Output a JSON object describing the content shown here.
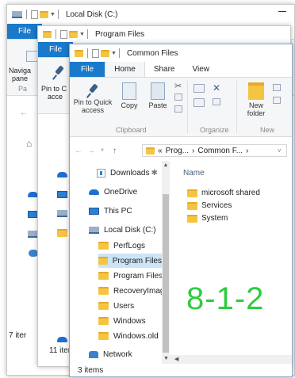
{
  "windows": {
    "local_disk": {
      "title": "Local Disk (C:)",
      "tab_file": "File",
      "ribbon_label_navigation": "Naviga",
      "ribbon_label_pane": "pane",
      "ribbon_label_pa": "Pa",
      "status": "7 iter"
    },
    "program_files": {
      "title": "Program Files",
      "tab_file": "File",
      "ribbon_label_pin": "Pin to C",
      "ribbon_label_acce": "acce",
      "status": "11 iter"
    },
    "common_files": {
      "title": "Common Files",
      "tabs": [
        "File",
        "Home",
        "Share",
        "View"
      ],
      "ribbon": {
        "pin_label_1": "Pin to Quick",
        "pin_label_2": "access",
        "copy": "Copy",
        "paste": "Paste",
        "new_folder_1": "New",
        "new_folder_2": "folder",
        "groups": [
          "Clipboard",
          "Organize",
          "New"
        ]
      },
      "address": {
        "sep": "«",
        "crumb1": "Prog...",
        "arrow1": "›",
        "crumb2": "Common F...",
        "arrow2": "›"
      },
      "nav": [
        {
          "label": "Downloads",
          "pin": "✱",
          "icon": "download-icon",
          "selected": false
        },
        {
          "label": "OneDrive",
          "icon": "cloud-icon",
          "selected": false
        },
        {
          "label": "This PC",
          "icon": "pc-icon",
          "selected": false
        },
        {
          "label": "Local Disk (C:)",
          "icon": "drive-icon",
          "selected": false
        },
        {
          "label": "PerfLogs",
          "icon": "folder-icon",
          "selected": false
        },
        {
          "label": "Program Files",
          "icon": "folder-icon",
          "selected": true
        },
        {
          "label": "Program Files",
          "icon": "folder-icon",
          "selected": false
        },
        {
          "label": "RecoveryImag",
          "icon": "folder-icon",
          "selected": false
        },
        {
          "label": "Users",
          "icon": "folder-icon",
          "selected": false
        },
        {
          "label": "Windows",
          "icon": "folder-icon",
          "selected": false
        },
        {
          "label": "Windows.old",
          "icon": "folder-icon",
          "selected": false
        },
        {
          "label": "Network",
          "icon": "network-icon",
          "selected": false
        }
      ],
      "column_name": "Name",
      "files": [
        "microsoft shared",
        "Services",
        "System"
      ],
      "status": "3 items"
    }
  },
  "overlay_text": "8-1-2",
  "colors": {
    "file_tab": "#1979ca",
    "selection": "#cce4f7",
    "folder": "#f5c542",
    "overlay": "#2ecc40"
  }
}
